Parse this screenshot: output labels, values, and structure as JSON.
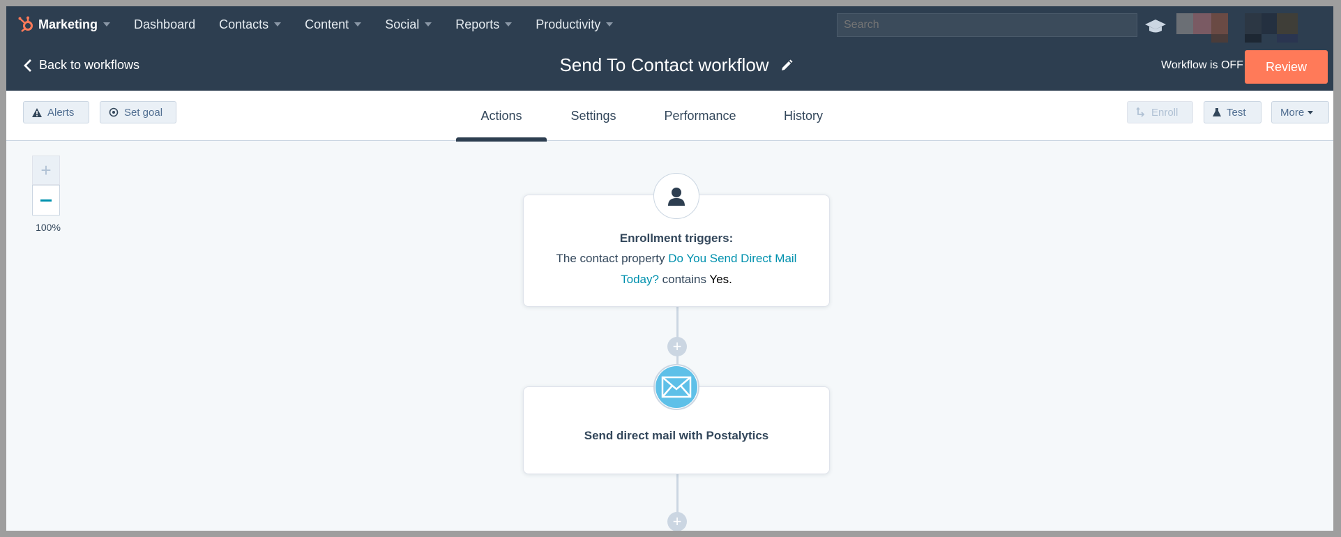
{
  "topnav": {
    "brand": "Marketing",
    "items": [
      "Dashboard",
      "Contacts",
      "Content",
      "Social",
      "Reports",
      "Productivity"
    ],
    "search_placeholder": "Search",
    "icons": {
      "brand": "hubspot-sprocket-icon",
      "academy": "graduation-cap-icon"
    }
  },
  "header": {
    "back_label": "Back to workflows",
    "title": "Send To Contact workflow",
    "status": "Workflow is OFF",
    "review_label": "Review"
  },
  "toolbar": {
    "alerts_label": "Alerts",
    "set_goal_label": "Set goal",
    "tabs": [
      "Actions",
      "Settings",
      "Performance",
      "History"
    ],
    "active_tab": "Actions",
    "enroll_label": "Enroll",
    "test_label": "Test",
    "more_label": "More"
  },
  "canvas": {
    "zoom_level": "100%",
    "trigger": {
      "title": "Enrollment triggers:",
      "prefix": "The contact property",
      "property": "Do You Send Direct Mail Today?",
      "operator": "contains",
      "value": "Yes."
    },
    "action": {
      "title": "Send direct mail with Postalytics"
    }
  },
  "colors": {
    "nav_bg": "#2d3e50",
    "accent": "#ff7a59",
    "link": "#0091ae",
    "canvas_bg": "#f5f8fa"
  }
}
